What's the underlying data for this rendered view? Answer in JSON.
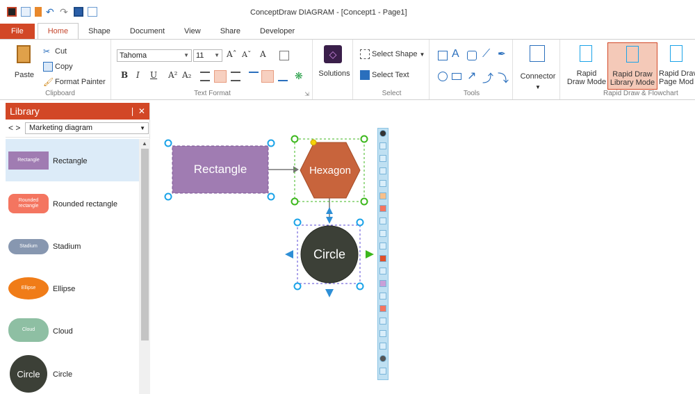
{
  "window": {
    "title": "ConceptDraw DIAGRAM - [Concept1 - Page1]"
  },
  "tabs": [
    "File",
    "Home",
    "Shape",
    "Document",
    "View",
    "Share",
    "Developer"
  ],
  "clipboard": {
    "paste": "Paste",
    "cut": "Cut",
    "copy": "Copy",
    "format_painter": "Format Painter",
    "group_label": "Clipboard"
  },
  "text_format": {
    "font": "Tahoma",
    "size": "11",
    "group_label": "Text Format"
  },
  "solutions": {
    "label": "Solutions"
  },
  "select": {
    "select_shape": "Select Shape",
    "select_text": "Select Text",
    "group_label": "Select"
  },
  "tools": {
    "group_label": "Tools"
  },
  "connector": {
    "label": "Connector"
  },
  "rapid_draw": {
    "rapid_draw_mode_1": "Rapid",
    "rapid_draw_mode_2": "Draw Mode",
    "library_mode_1": "Rapid Draw",
    "library_mode_2": "Library Mode",
    "page_mode_1": "Rapid Drav",
    "page_mode_2": "Page Mod",
    "group_label": "Rapid Draw & Flowchart"
  },
  "library": {
    "title": "Library",
    "controls": "❘ ✕",
    "nav": "< >",
    "selected": "Marketing diagram",
    "items": [
      {
        "thumb": "Rectangle",
        "label": "Rectangle"
      },
      {
        "thumb": "Rounded rectangle",
        "label": "Rounded rectangle"
      },
      {
        "thumb": "Stadium",
        "label": "Stadium"
      },
      {
        "thumb": "Ellipse",
        "label": "Ellipse"
      },
      {
        "thumb": "Cloud",
        "label": "Cloud"
      },
      {
        "thumb": "Circle",
        "label": "Circle"
      }
    ]
  },
  "canvas": {
    "rectangle": "Rectangle",
    "hexagon": "Hexagon",
    "circle": "Circle"
  },
  "colors": {
    "accent": "#d24726",
    "rect_fill": "#a07cb2",
    "hex_fill": "#c8643c",
    "circle_fill": "#3c4037",
    "handle_blue": "#1aa3e8",
    "handle_green": "#3cb71c"
  }
}
